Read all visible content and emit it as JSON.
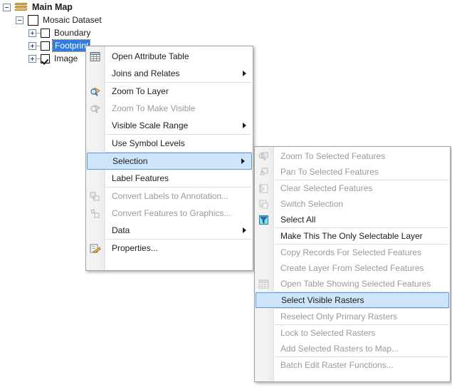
{
  "toc": {
    "nodes": [
      {
        "label": "Main Map",
        "icon": "map-layers-icon",
        "expander": "minus",
        "checkbox": "none",
        "bold": true,
        "selected": false
      },
      {
        "label": "Mosaic Dataset",
        "icon": "checkbox",
        "expander": "minus",
        "checkbox": "unchecked",
        "bold": false,
        "selected": false
      },
      {
        "label": "Boundary",
        "icon": "checkbox",
        "expander": "plus",
        "checkbox": "unchecked",
        "bold": false,
        "selected": false
      },
      {
        "label": "Footprint",
        "icon": "checkbox",
        "expander": "plus",
        "checkbox": "unchecked",
        "bold": false,
        "selected": true
      },
      {
        "label": "Image",
        "icon": "checkbox",
        "expander": "plus",
        "checkbox": "checked",
        "bold": false,
        "selected": false
      }
    ]
  },
  "context_menu": {
    "items": [
      {
        "label": "Open Attribute Table",
        "icon": "table-icon",
        "disabled": false,
        "submenu": false,
        "selected": false,
        "sep_after": false
      },
      {
        "label": "Joins and Relates",
        "icon": "none",
        "disabled": false,
        "submenu": true,
        "selected": false,
        "sep_after": true
      },
      {
        "label": "Zoom To Layer",
        "icon": "zoom-to-layer-icon",
        "disabled": false,
        "submenu": false,
        "selected": false,
        "sep_after": false
      },
      {
        "label": "Zoom To Make Visible",
        "icon": "zoom-make-visible-icon",
        "disabled": true,
        "submenu": false,
        "selected": false,
        "sep_after": false
      },
      {
        "label": "Visible Scale Range",
        "icon": "none",
        "disabled": false,
        "submenu": true,
        "selected": false,
        "sep_after": true
      },
      {
        "label": "Use Symbol Levels",
        "icon": "none",
        "disabled": false,
        "submenu": false,
        "selected": false,
        "sep_after": true
      },
      {
        "label": "Selection",
        "icon": "none",
        "disabled": false,
        "submenu": true,
        "selected": true,
        "sep_after": false
      },
      {
        "label": "Label Features",
        "icon": "none",
        "disabled": false,
        "submenu": false,
        "selected": false,
        "sep_after": true
      },
      {
        "label": "Convert Labels to Annotation...",
        "icon": "convert-labels-icon",
        "disabled": true,
        "submenu": false,
        "selected": false,
        "sep_after": false
      },
      {
        "label": "Convert Features to Graphics...",
        "icon": "convert-features-icon",
        "disabled": true,
        "submenu": false,
        "selected": false,
        "sep_after": false
      },
      {
        "label": "Data",
        "icon": "none",
        "disabled": false,
        "submenu": true,
        "selected": false,
        "sep_after": true
      },
      {
        "label": "Properties...",
        "icon": "properties-icon",
        "disabled": false,
        "submenu": false,
        "selected": false,
        "sep_after": false
      }
    ]
  },
  "selection_submenu": {
    "items": [
      {
        "label": "Zoom To Selected Features",
        "icon": "zoom-selected-icon",
        "disabled": true,
        "selected": false,
        "sep_after": false
      },
      {
        "label": "Pan To Selected Features",
        "icon": "pan-selected-icon",
        "disabled": true,
        "selected": false,
        "sep_after": true
      },
      {
        "label": "Clear Selected Features",
        "icon": "clear-selected-icon",
        "disabled": true,
        "selected": false,
        "sep_after": false
      },
      {
        "label": "Switch Selection",
        "icon": "switch-selection-icon",
        "disabled": true,
        "selected": false,
        "sep_after": false
      },
      {
        "label": "Select All",
        "icon": "select-all-icon",
        "disabled": false,
        "selected": false,
        "sep_after": true
      },
      {
        "label": "Make This The Only Selectable Layer",
        "icon": "none",
        "disabled": false,
        "selected": false,
        "sep_after": true
      },
      {
        "label": "Copy Records For Selected Features",
        "icon": "none",
        "disabled": true,
        "selected": false,
        "sep_after": false
      },
      {
        "label": "Create Layer From Selected Features",
        "icon": "none",
        "disabled": true,
        "selected": false,
        "sep_after": false
      },
      {
        "label": "Open Table Showing Selected Features",
        "icon": "table-icon",
        "disabled": true,
        "selected": false,
        "sep_after": true
      },
      {
        "label": "Select Visible Rasters",
        "icon": "none",
        "disabled": false,
        "selected": true,
        "sep_after": true
      },
      {
        "label": "Reselect Only Primary Rasters",
        "icon": "none",
        "disabled": true,
        "selected": false,
        "sep_after": true
      },
      {
        "label": "Lock to Selected Rasters",
        "icon": "none",
        "disabled": true,
        "selected": false,
        "sep_after": false
      },
      {
        "label": "Add Selected Rasters to Map...",
        "icon": "none",
        "disabled": true,
        "selected": false,
        "sep_after": true
      },
      {
        "label": "Batch Edit Raster Functions...",
        "icon": "none",
        "disabled": true,
        "selected": false,
        "sep_after": false
      }
    ]
  },
  "colors": {
    "highlight_fill": "#cde4fb",
    "highlight_border": "#5b9ae0",
    "tree_selection": "#2f7ce0",
    "menu_background": "#ffffff",
    "gutter": "#f1f1f1",
    "disabled_text": "#9a9a9a",
    "text": "#1d1d1d"
  }
}
